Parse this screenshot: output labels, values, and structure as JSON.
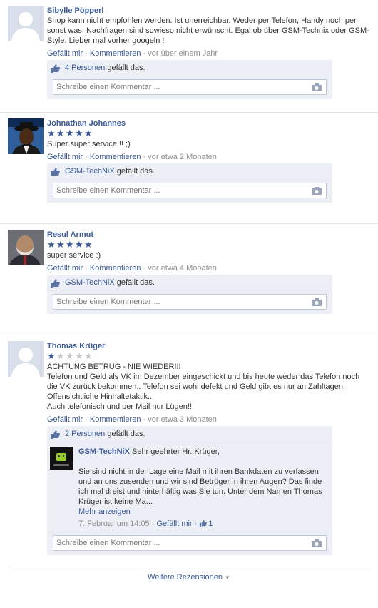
{
  "reviews": [
    {
      "name": "Sibylle Pöpperl",
      "avatar": "default-silhouette",
      "stars": 0,
      "text": "Shop kann nicht empfohlen werden. Ist unerreichbar. Weder per Telefon, Handy noch per sonst was. Nachfragen sind sowieso nicht erwünscht. Egal ob über GSM-Technix oder GSM-Style. Lieber mal vorher googeln !",
      "like": "Gefällt mir",
      "comment": "Kommentieren",
      "time": "vor über einem Jahr",
      "likes_link": "4 Personen",
      "likes_suffix": "gefällt das.",
      "placeholder": "Schreibe einen Kommentar ..."
    },
    {
      "name": "Johnathan Johannes",
      "avatar": "photo-man-hat",
      "stars": 5,
      "text": "Super super service !! ;)",
      "like": "Gefällt mir",
      "comment": "Kommentieren",
      "time": "vor etwa 2 Monaten",
      "likes_link": "GSM-TechNiX",
      "likes_suffix": "gefällt das.",
      "placeholder": "Schreibe einen Kommentar ..."
    },
    {
      "name": "Resul Armut",
      "avatar": "photo-man-beard",
      "stars": 5,
      "text": "super service :)",
      "like": "Gefällt mir",
      "comment": "Kommentieren",
      "time": "vor etwa 4 Monaten",
      "likes_link": "GSM-TechNiX",
      "likes_suffix": "gefällt das.",
      "placeholder": "Schreibe einen Kommentar ..."
    },
    {
      "name": "Thomas Krüger",
      "avatar": "default-silhouette",
      "stars": 1,
      "text_lines": [
        "ACHTUNG BETRUG - NIE WIEDER!!!",
        "Telefon und Geld als VK im Dezember eingeschickt und bis heute weder das Telefon noch die VK zurück bekommen.. Telefon sei wohl defekt und Geld gibt es nur an Zahltagen. Offensichtliche Hinhaltetaktik..",
        "Auch telefonisch und per Mail nur Lügen!!"
      ],
      "like": "Gefällt mir",
      "comment": "Kommentieren",
      "time": "vor etwa 3 Monaten",
      "likes_link": "2 Personen",
      "likes_suffix": "gefällt das.",
      "reply": {
        "author": "GSM-TechNiX",
        "greeting": "Sehr geehrter Hr. Krüger,",
        "body": "Sie sind nicht in der Lage eine Mail mit ihren Bankdaten zu verfassen und an uns zusenden und wir sind Betrüger in ihren Augen? Das finde ich mal dreist und hinterhältig was Sie tun. Unter dem Namen Thomas Krüger ist keine Ma...",
        "more": "Mehr anzeigen",
        "date": "7. Februar um 14:05",
        "like": "Gefällt mir",
        "like_count": "1"
      },
      "placeholder": "Schreibe einen Kommentar ..."
    }
  ],
  "footer": {
    "more_reviews": "Weitere Rezensionen"
  },
  "colors": {
    "link": "#3b5998",
    "panel": "#eceff5",
    "muted": "#8f8f8f"
  }
}
